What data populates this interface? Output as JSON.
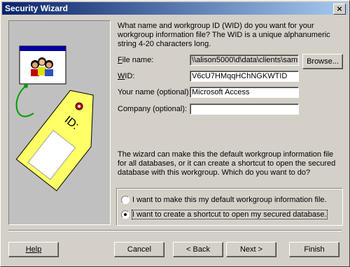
{
  "window": {
    "title": "Security Wizard",
    "close_glyph": "×"
  },
  "description": "What name and workgroup ID (WID) do you want for your workgroup information file? The WID is a unique alphanumeric string 4-20 characters long.",
  "fields": {
    "file_name": {
      "label_mnemonic": "F",
      "label_rest": "ile name:",
      "value": "\\\\alison5000\\d\\data\\clients\\sams\\"
    },
    "wid": {
      "label_mnemonic": "W",
      "label_rest": "ID:",
      "value": "V6cU7HMqqHChNGKWTID"
    },
    "your_name": {
      "label": "Your name (optional):",
      "value": "Microsoft Access"
    },
    "company": {
      "label": "Company (optional):",
      "value": ""
    }
  },
  "browse_button": "Browse...",
  "info": "The wizard can make this the default workgroup information file for all databases, or it can create a shortcut to open the secured database with this workgroup. Which do you want to do?",
  "options": [
    {
      "label": "I want to make this my default workgroup information file.",
      "selected": false
    },
    {
      "label": "I want to create a shortcut to open my secured database.",
      "selected": true
    }
  ],
  "buttons": {
    "help": "Help",
    "cancel": "Cancel",
    "back": "< Back",
    "next": "Next >",
    "finish": "Finish"
  },
  "art": {
    "tag_text": "ID:"
  },
  "colors": {
    "title_start": "#0a246a",
    "title_end": "#a6caf0",
    "tag": "#ffff66"
  }
}
